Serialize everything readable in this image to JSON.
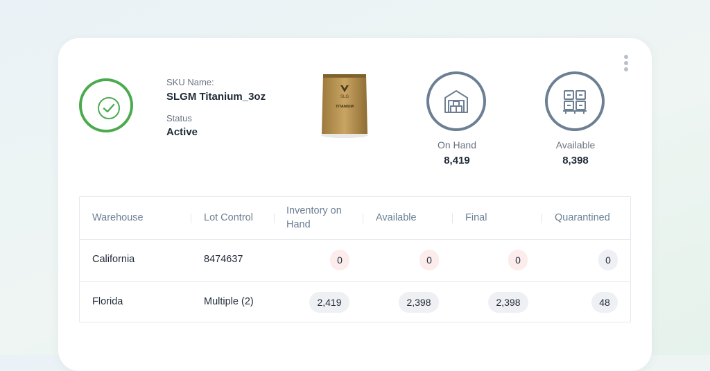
{
  "sku": {
    "name_label": "SKU Name:",
    "name": "SLGM Titanium_3oz",
    "status_label": "Status",
    "status": "Active"
  },
  "product": {
    "brand": "SLG",
    "name": "TITANIUM"
  },
  "stats": {
    "on_hand": {
      "label": "On Hand",
      "value": "8,419",
      "icon": "warehouse-icon"
    },
    "available": {
      "label": "Available",
      "value": "8,398",
      "icon": "pallet-boxes-icon"
    }
  },
  "colors": {
    "status_active": "#4caa4e",
    "icon_ring": "#6c7f93",
    "zero_pill": "#fdecec",
    "value_pill": "#eef0f3"
  },
  "table": {
    "headers": [
      "Warehouse",
      "Lot Control",
      "Inventory on Hand",
      "Available",
      "Final",
      "Quarantined"
    ],
    "header_lines": {
      "inv_1": "Inventory on",
      "inv_2": "Hand"
    },
    "rows": [
      {
        "warehouse": "California",
        "lot": "8474637",
        "inventory": "0",
        "available": "0",
        "final": "0",
        "quarantined": "0"
      },
      {
        "warehouse": "Florida",
        "lot": "Multiple (2)",
        "inventory": "2,419",
        "available": "2,398",
        "final": "2,398",
        "quarantined": "48"
      }
    ]
  }
}
